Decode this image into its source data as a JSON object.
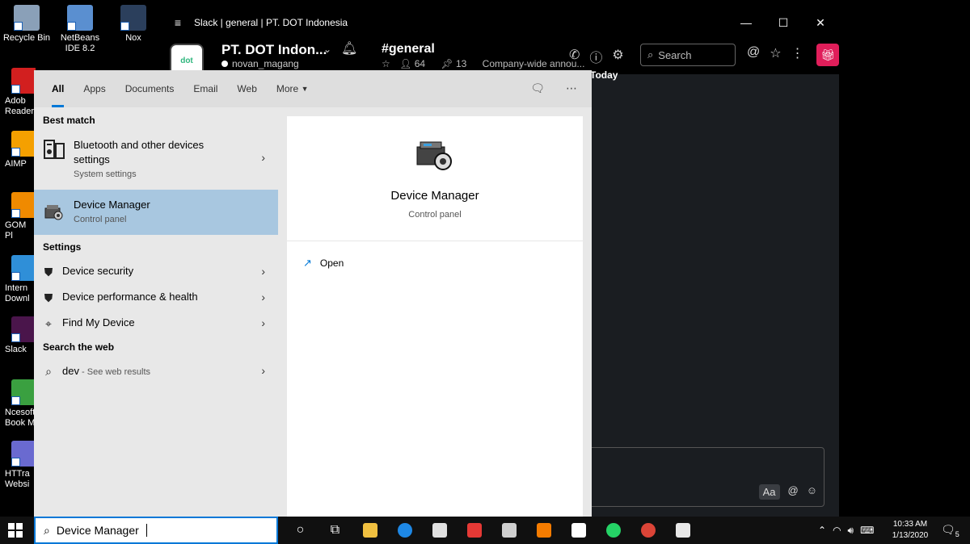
{
  "desktop": {
    "icons": [
      {
        "label": "Recycle Bin",
        "color": "#8aa0b8"
      },
      {
        "label": "NetBeans IDE 8.2",
        "color": "#5a8fd0"
      },
      {
        "label": "Nox",
        "color": "#2b3f5c"
      },
      {
        "label": "Adob Reader",
        "color": "#d21f1f"
      },
      {
        "label": "AIMP",
        "color": "#f5a000"
      },
      {
        "label": "GOM Pl",
        "color": "#f08a00"
      },
      {
        "label": "Intern Downl",
        "color": "#2f8fd8"
      },
      {
        "label": "Slack",
        "color": "#4a154b"
      },
      {
        "label": "Ncesoft Book M",
        "color": "#3aa040"
      },
      {
        "label": "HTTra Websi",
        "color": "#6a6ad0"
      }
    ]
  },
  "slack": {
    "window_title": "Slack | general | PT. DOT Indonesia",
    "menu_icon": "hamburger-icon",
    "workspace_logo": "dot",
    "workspace_name": "PT. DOT Indon...",
    "user": "novan_magang",
    "channel": "#general",
    "members": "64",
    "pins": "13",
    "topic": "Company-wide annou...",
    "search_placeholder": "Search",
    "today_label": "Today",
    "composer_aa": "Aa",
    "accent": "#e01e5a"
  },
  "search": {
    "tabs": [
      "All",
      "Apps",
      "Documents",
      "Email",
      "Web",
      "More"
    ],
    "best_match_header": "Best match",
    "best_match": [
      {
        "title_line1": "Bluetooth and other devices",
        "title_line2": "settings",
        "sub": "System settings"
      },
      {
        "title": "Device Manager",
        "sub": "Control panel"
      }
    ],
    "settings_header": "Settings",
    "settings": [
      {
        "title": "Device security"
      },
      {
        "title": "Device performance & health"
      },
      {
        "title": "Find My Device"
      }
    ],
    "web_header": "Search the web",
    "web_query": "dev",
    "web_sub": " - See web results",
    "preview": {
      "title": "Device Manager",
      "sub": "Control panel",
      "action": "Open"
    },
    "query": "Device Manager"
  },
  "taskbar": {
    "time": "10:33 AM",
    "date": "1/13/2020",
    "notif_count": "5"
  }
}
